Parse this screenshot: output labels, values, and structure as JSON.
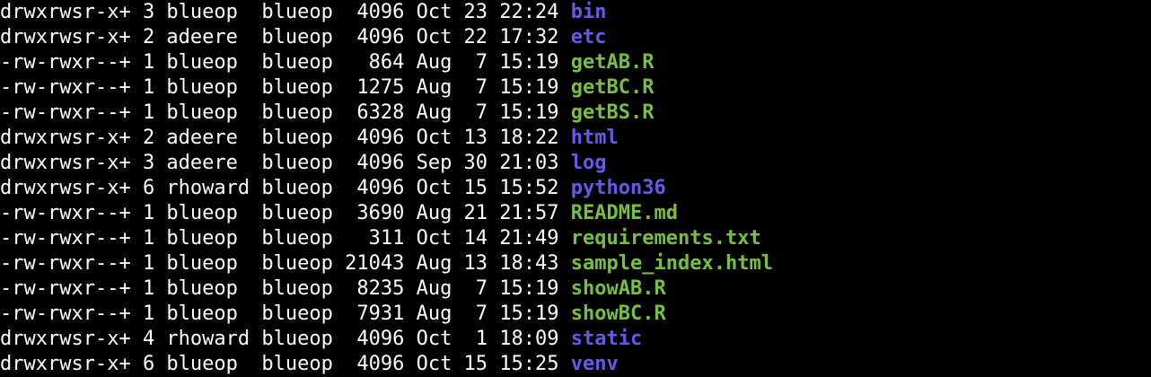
{
  "colors": {
    "background": "#000000",
    "text": "#ffffff",
    "directory": "#6b56e8",
    "file": "#77bf3f"
  },
  "listing": [
    {
      "perms": "drwxrwsr-x+",
      "links": "3",
      "owner": "blueop",
      "group": "blueop",
      "size": "4096",
      "month": "Oct",
      "day": "23",
      "time": "22:24",
      "name": "bin",
      "kind": "dir"
    },
    {
      "perms": "drwxrwsr-x+",
      "links": "2",
      "owner": "adeere",
      "group": "blueop",
      "size": "4096",
      "month": "Oct",
      "day": "22",
      "time": "17:32",
      "name": "etc",
      "kind": "dir"
    },
    {
      "perms": "-rw-rwxr--+",
      "links": "1",
      "owner": "blueop",
      "group": "blueop",
      "size": "864",
      "month": "Aug",
      "day": "7",
      "time": "15:19",
      "name": "getAB.R",
      "kind": "file"
    },
    {
      "perms": "-rw-rwxr--+",
      "links": "1",
      "owner": "blueop",
      "group": "blueop",
      "size": "1275",
      "month": "Aug",
      "day": "7",
      "time": "15:19",
      "name": "getBC.R",
      "kind": "file"
    },
    {
      "perms": "-rw-rwxr--+",
      "links": "1",
      "owner": "blueop",
      "group": "blueop",
      "size": "6328",
      "month": "Aug",
      "day": "7",
      "time": "15:19",
      "name": "getBS.R",
      "kind": "file"
    },
    {
      "perms": "drwxrwsr-x+",
      "links": "2",
      "owner": "adeere",
      "group": "blueop",
      "size": "4096",
      "month": "Oct",
      "day": "13",
      "time": "18:22",
      "name": "html",
      "kind": "dir"
    },
    {
      "perms": "drwxrwsr-x+",
      "links": "3",
      "owner": "adeere",
      "group": "blueop",
      "size": "4096",
      "month": "Sep",
      "day": "30",
      "time": "21:03",
      "name": "log",
      "kind": "dir"
    },
    {
      "perms": "drwxrwsr-x+",
      "links": "6",
      "owner": "rhoward",
      "group": "blueop",
      "size": "4096",
      "month": "Oct",
      "day": "15",
      "time": "15:52",
      "name": "python36",
      "kind": "dir"
    },
    {
      "perms": "-rw-rwxr--+",
      "links": "1",
      "owner": "blueop",
      "group": "blueop",
      "size": "3690",
      "month": "Aug",
      "day": "21",
      "time": "21:57",
      "name": "README.md",
      "kind": "file"
    },
    {
      "perms": "-rw-rwxr--+",
      "links": "1",
      "owner": "blueop",
      "group": "blueop",
      "size": "311",
      "month": "Oct",
      "day": "14",
      "time": "21:49",
      "name": "requirements.txt",
      "kind": "file"
    },
    {
      "perms": "-rw-rwxr--+",
      "links": "1",
      "owner": "blueop",
      "group": "blueop",
      "size": "21043",
      "month": "Aug",
      "day": "13",
      "time": "18:43",
      "name": "sample_index.html",
      "kind": "file"
    },
    {
      "perms": "-rw-rwxr--+",
      "links": "1",
      "owner": "blueop",
      "group": "blueop",
      "size": "8235",
      "month": "Aug",
      "day": "7",
      "time": "15:19",
      "name": "showAB.R",
      "kind": "file"
    },
    {
      "perms": "-rw-rwxr--+",
      "links": "1",
      "owner": "blueop",
      "group": "blueop",
      "size": "7931",
      "month": "Aug",
      "day": "7",
      "time": "15:19",
      "name": "showBC.R",
      "kind": "file"
    },
    {
      "perms": "drwxrwsr-x+",
      "links": "4",
      "owner": "rhoward",
      "group": "blueop",
      "size": "4096",
      "month": "Oct",
      "day": "1",
      "time": "18:09",
      "name": "static",
      "kind": "dir"
    },
    {
      "perms": "drwxrwsr-x+",
      "links": "6",
      "owner": "blueop",
      "group": "blueop",
      "size": "4096",
      "month": "Oct",
      "day": "15",
      "time": "15:25",
      "name": "venv",
      "kind": "dir"
    }
  ]
}
